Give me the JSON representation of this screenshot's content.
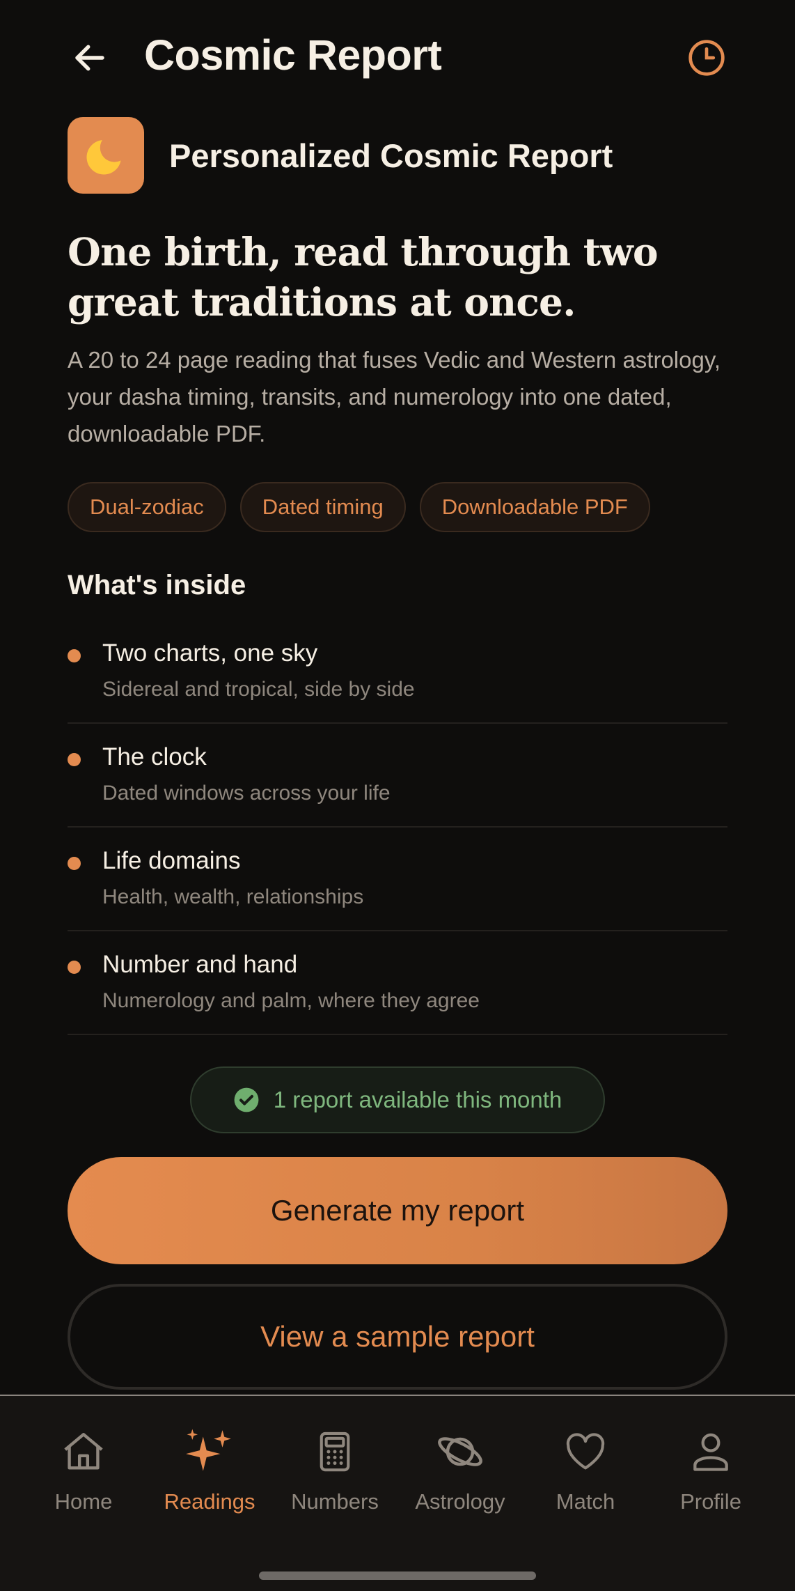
{
  "header": {
    "title": "Cosmic Report",
    "back_icon": "arrow-left-icon",
    "history_icon": "clock-icon"
  },
  "product": {
    "icon": "crescent-moon-icon",
    "name": "Personalized Cosmic Report"
  },
  "headline": "One birth, read through two great traditions at once.",
  "description": "A 20 to 24 page reading that fuses Vedic and Western astrology, your dasha timing, transits, and numerology into one dated, downloadable PDF.",
  "chips": [
    "Dual-zodiac",
    "Dated timing",
    "Downloadable PDF"
  ],
  "inside": {
    "title": "What's inside",
    "items": [
      {
        "title": "Two charts, one sky",
        "subtitle": "Sidereal and tropical, side by side"
      },
      {
        "title": "The clock",
        "subtitle": "Dated windows across your life"
      },
      {
        "title": "Life domains",
        "subtitle": "Health, wealth, relationships"
      },
      {
        "title": "Number and hand",
        "subtitle": "Numerology and palm, where they agree"
      }
    ]
  },
  "status": {
    "icon": "check-circle-icon",
    "text": "1 report available this month"
  },
  "actions": {
    "primary": "Generate my report",
    "secondary": "View a sample report"
  },
  "nav": {
    "active": "Readings",
    "items": [
      {
        "label": "Home",
        "icon": "home-icon"
      },
      {
        "label": "Readings",
        "icon": "sparkles-icon"
      },
      {
        "label": "Numbers",
        "icon": "calculator-icon"
      },
      {
        "label": "Astrology",
        "icon": "planet-icon"
      },
      {
        "label": "Match",
        "icon": "heart-icon"
      },
      {
        "label": "Profile",
        "icon": "user-icon"
      }
    ]
  },
  "colors": {
    "background": "#0e0d0c",
    "accent": "#e38b50",
    "success": "#7fb77e",
    "text": "#f6efe4",
    "muted": "#8f877e"
  }
}
